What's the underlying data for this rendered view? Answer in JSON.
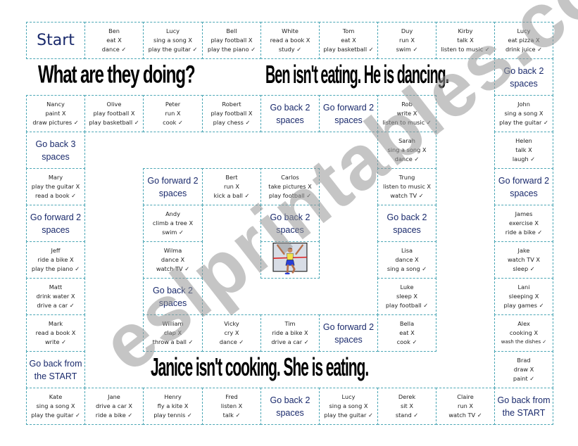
{
  "headings": {
    "question": "What are they doing?",
    "example_ben": "Ben isn't eating. He is dancing.",
    "example_janice": "Janice isn't cooking. She is eating."
  },
  "watermark": "eslprintables.com",
  "finish_image": "runner-crossing-finish-line",
  "symbols": {
    "not_doing": "X",
    "doing": "✓"
  },
  "cells": [
    {
      "id": "start",
      "row": 0,
      "col": 0,
      "type": "start",
      "label": "Start"
    },
    {
      "id": "ben",
      "row": 0,
      "col": 1,
      "type": "person",
      "name": "Ben",
      "no": "eat X",
      "yes": "dance ✓"
    },
    {
      "id": "lucy-1",
      "row": 0,
      "col": 2,
      "type": "person",
      "name": "Lucy",
      "no": "sing a song X",
      "yes": "play the guitar ✓"
    },
    {
      "id": "bell",
      "row": 0,
      "col": 3,
      "type": "person",
      "name": "Bell",
      "no": "play football X",
      "yes": "play the piano ✓"
    },
    {
      "id": "white",
      "row": 0,
      "col": 4,
      "type": "person",
      "name": "White",
      "no": "read a book X",
      "yes": "study ✓"
    },
    {
      "id": "tom",
      "row": 0,
      "col": 5,
      "type": "person",
      "name": "Tom",
      "no": "eat X",
      "yes": "play basketball ✓"
    },
    {
      "id": "duy",
      "row": 0,
      "col": 6,
      "type": "person",
      "name": "Duy",
      "no": "run X",
      "yes": "swim ✓"
    },
    {
      "id": "kirby",
      "row": 0,
      "col": 7,
      "type": "person",
      "name": "Kirby",
      "no": "talk X",
      "yes": "listen to music ✓"
    },
    {
      "id": "lucy-2",
      "row": 0,
      "col": 8,
      "type": "person",
      "name": "Lucy",
      "no": "eat pizza X",
      "yes": "drink juice ✓"
    },
    {
      "id": "go-back-2-a",
      "row": 1,
      "col": 8,
      "type": "instruction",
      "line1": "Go back 2",
      "line2": "spaces"
    },
    {
      "id": "nancy",
      "row": 2,
      "col": 0,
      "type": "person",
      "name": "Nancy",
      "no": "paint X",
      "yes": "draw pictures ✓"
    },
    {
      "id": "olive",
      "row": 2,
      "col": 1,
      "type": "person",
      "name": "Olive",
      "no": "play football X",
      "yes": "play basketball ✓"
    },
    {
      "id": "peter",
      "row": 2,
      "col": 2,
      "type": "person",
      "name": "Peter",
      "no": "run X",
      "yes": "cook ✓"
    },
    {
      "id": "robert",
      "row": 2,
      "col": 3,
      "type": "person",
      "name": "Robert",
      "no": "play football X",
      "yes": "play chess ✓"
    },
    {
      "id": "go-back-2-b",
      "row": 2,
      "col": 4,
      "type": "instruction",
      "line1": "Go back 2",
      "line2": "spaces"
    },
    {
      "id": "go-forward-2-a",
      "row": 2,
      "col": 5,
      "type": "instruction",
      "line1": "Go forward 2",
      "line2": "spaces"
    },
    {
      "id": "rob",
      "row": 2,
      "col": 6,
      "type": "person",
      "name": "Rob",
      "no": "write X",
      "yes": "listen to music ✓"
    },
    {
      "id": "john",
      "row": 2,
      "col": 8,
      "type": "person",
      "name": "John",
      "no": "sing a song X",
      "yes": "play the guitar ✓"
    },
    {
      "id": "go-back-3",
      "row": 3,
      "col": 0,
      "type": "instruction",
      "line1": "Go back 3",
      "line2": "spaces"
    },
    {
      "id": "sarah",
      "row": 3,
      "col": 6,
      "type": "person",
      "name": "Sarah",
      "no": "sing a song X",
      "yes": "dance ✓"
    },
    {
      "id": "helen",
      "row": 3,
      "col": 8,
      "type": "person",
      "name": "Helen",
      "no": "talk X",
      "yes": "laugh ✓"
    },
    {
      "id": "mary",
      "row": 4,
      "col": 0,
      "type": "person",
      "name": "Mary",
      "no": "play the guitar X",
      "yes": "read a book ✓"
    },
    {
      "id": "go-forward-2-b",
      "row": 4,
      "col": 2,
      "type": "instruction",
      "line1": "Go forward 2",
      "line2": "spaces"
    },
    {
      "id": "bert",
      "row": 4,
      "col": 3,
      "type": "person",
      "name": "Bert",
      "no": "run X",
      "yes": "kick a ball ✓"
    },
    {
      "id": "carlos",
      "row": 4,
      "col": 4,
      "type": "person",
      "name": "Carlos",
      "no": "take pictures X",
      "yes": "play football ✓"
    },
    {
      "id": "trung",
      "row": 4,
      "col": 6,
      "type": "person",
      "name": "Trung",
      "no": "listen to music X",
      "yes": "watch TV ✓"
    },
    {
      "id": "go-forward-2-c",
      "row": 4,
      "col": 8,
      "type": "instruction",
      "line1": "Go forward 2",
      "line2": "spaces"
    },
    {
      "id": "go-forward-2-d",
      "row": 5,
      "col": 0,
      "type": "instruction",
      "line1": "Go forward 2",
      "line2": "spaces"
    },
    {
      "id": "andy",
      "row": 5,
      "col": 2,
      "type": "person",
      "name": "Andy",
      "no": "climb a tree X",
      "yes": "swim ✓"
    },
    {
      "id": "go-back-2-c",
      "row": 5,
      "col": 4,
      "type": "instruction",
      "line1": "Go back 2",
      "line2": "spaces"
    },
    {
      "id": "go-back-2-d",
      "row": 5,
      "col": 6,
      "type": "instruction",
      "line1": "Go back 2",
      "line2": "spaces"
    },
    {
      "id": "james",
      "row": 5,
      "col": 8,
      "type": "person",
      "name": "James",
      "no": "exercise X",
      "yes": "ride a bike ✓"
    },
    {
      "id": "jeff",
      "row": 6,
      "col": 0,
      "type": "person",
      "name": "Jeff",
      "no": "ride a bike X",
      "yes": "play the piano ✓"
    },
    {
      "id": "wilma",
      "row": 6,
      "col": 2,
      "type": "person",
      "name": "Wilma",
      "no": "dance X",
      "yes": "watch TV ✓"
    },
    {
      "id": "finish",
      "row": 6,
      "col": 4,
      "type": "image"
    },
    {
      "id": "lisa",
      "row": 6,
      "col": 6,
      "type": "person",
      "name": "Lisa",
      "no": "dance X",
      "yes": "sing a song ✓"
    },
    {
      "id": "jake",
      "row": 6,
      "col": 8,
      "type": "person",
      "name": "Jake",
      "no": "watch TV X",
      "yes": "sleep ✓"
    },
    {
      "id": "matt",
      "row": 7,
      "col": 0,
      "type": "person",
      "name": "Matt",
      "no": "drink water X",
      "yes": "drive a car ✓"
    },
    {
      "id": "go-back-2-e",
      "row": 7,
      "col": 2,
      "type": "instruction",
      "line1": "Go back 2",
      "line2": "spaces"
    },
    {
      "id": "luke",
      "row": 7,
      "col": 6,
      "type": "person",
      "name": "Luke",
      "no": "sleep X",
      "yes": "play football ✓"
    },
    {
      "id": "lani",
      "row": 7,
      "col": 8,
      "type": "person",
      "name": "Lani",
      "no": "sleeping X",
      "yes": "play games ✓"
    },
    {
      "id": "mark",
      "row": 8,
      "col": 0,
      "type": "person",
      "name": "Mark",
      "no": "read a book X",
      "yes": "write ✓"
    },
    {
      "id": "william",
      "row": 8,
      "col": 2,
      "type": "person",
      "name": "William",
      "no": "clap X",
      "yes": "throw a ball ✓"
    },
    {
      "id": "vicky",
      "row": 8,
      "col": 3,
      "type": "person",
      "name": "Vicky",
      "no": "cry X",
      "yes": "dance ✓"
    },
    {
      "id": "tim",
      "row": 8,
      "col": 4,
      "type": "person",
      "name": "Tim",
      "no": "ride a bike X",
      "yes": "drive a car ✓"
    },
    {
      "id": "go-forward-2-e",
      "row": 8,
      "col": 5,
      "type": "instruction",
      "line1": "Go forward 2",
      "line2": "spaces"
    },
    {
      "id": "bella",
      "row": 8,
      "col": 6,
      "type": "person",
      "name": "Bella",
      "no": "eat X",
      "yes": "cook ✓"
    },
    {
      "id": "alex",
      "row": 8,
      "col": 8,
      "type": "person",
      "name": "Alex",
      "no": "cooking X",
      "yes": "wash the dishes ✓",
      "small": true
    },
    {
      "id": "go-back-start-a",
      "row": 9,
      "col": 0,
      "type": "instruction",
      "line1": "Go back from",
      "line2": "the START"
    },
    {
      "id": "brad",
      "row": 9,
      "col": 8,
      "type": "person",
      "name": "Brad",
      "no": "draw X",
      "yes": "paint ✓"
    },
    {
      "id": "kate",
      "row": 10,
      "col": 0,
      "type": "person",
      "name": "Kate",
      "no": "sing a song X",
      "yes": "play the guitar ✓"
    },
    {
      "id": "jane",
      "row": 10,
      "col": 1,
      "type": "person",
      "name": "Jane",
      "no": "drive a car X",
      "yes": "ride a bike ✓"
    },
    {
      "id": "henry",
      "row": 10,
      "col": 2,
      "type": "person",
      "name": "Henry",
      "no": "fly a kite X",
      "yes": "play tennis ✓"
    },
    {
      "id": "fred",
      "row": 10,
      "col": 3,
      "type": "person",
      "name": "Fred",
      "no": "listen X",
      "yes": "talk ✓"
    },
    {
      "id": "go-back-2-f",
      "row": 10,
      "col": 4,
      "type": "instruction",
      "line1": "Go back 2",
      "line2": "spaces"
    },
    {
      "id": "lucy-3",
      "row": 10,
      "col": 5,
      "type": "person",
      "name": "Lucy",
      "no": "sing a song X",
      "yes": "play the guitar ✓"
    },
    {
      "id": "derek",
      "row": 10,
      "col": 6,
      "type": "person",
      "name": "Derek",
      "no": "sit X",
      "yes": "stand ✓"
    },
    {
      "id": "claire",
      "row": 10,
      "col": 7,
      "type": "person",
      "name": "Claire",
      "no": "run X",
      "yes": "watch TV ✓"
    },
    {
      "id": "go-back-start-b",
      "row": 10,
      "col": 8,
      "type": "instruction",
      "line1": "Go back from",
      "line2": "the START"
    }
  ]
}
